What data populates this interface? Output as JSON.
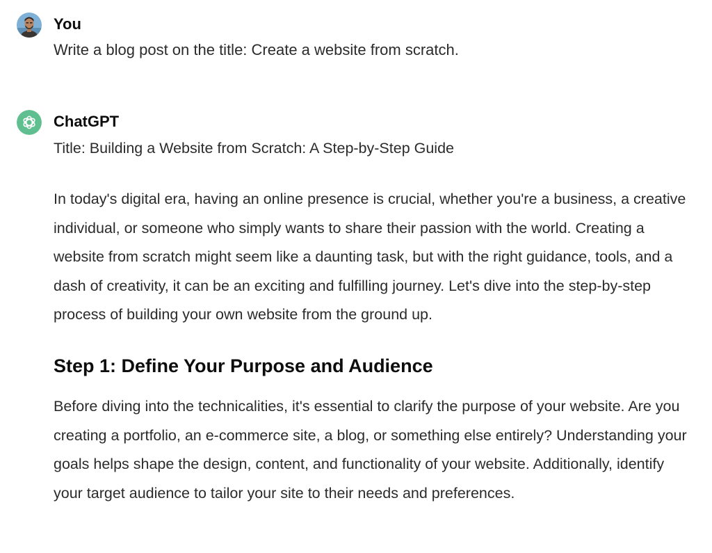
{
  "conversation": {
    "user": {
      "avatar_icon": "user-photo-avatar",
      "name": "You",
      "message": "Write a blog post on the title: Create a website from scratch."
    },
    "assistant": {
      "avatar_icon": "openai-logo-icon",
      "avatar_color": "#5fbf8f",
      "name": "ChatGPT",
      "title_line": "Title: Building a Website from Scratch: A Step-by-Step Guide",
      "intro": "In today's digital era, having an online presence is crucial, whether you're a business, a creative individual, or someone who simply wants to share their passion with the world. Creating a website from scratch might seem like a daunting task, but with the right guidance, tools, and a dash of creativity, it can be an exciting and fulfilling journey. Let's dive into the step-by-step process of building your own website from the ground up.",
      "step1": {
        "heading": "Step 1: Define Your Purpose and Audience",
        "body": "Before diving into the technicalities, it's essential to clarify the purpose of your website. Are you creating a portfolio, an e-commerce site, a blog, or something else entirely? Understanding your goals helps shape the design, content, and functionality of your website. Additionally, identify your target audience to tailor your site to their needs and preferences."
      }
    }
  }
}
